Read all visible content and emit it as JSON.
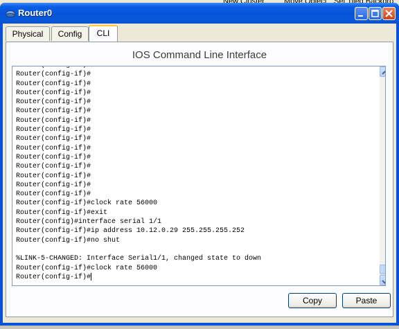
{
  "background": {
    "items": [
      "New Cluster",
      "Move Object",
      "Set Tiled Backgro"
    ]
  },
  "window": {
    "title": "Router0",
    "controls": [
      "minimize-icon",
      "maximize-icon",
      "close-icon"
    ]
  },
  "tabs": [
    {
      "label": "Physical",
      "active": false
    },
    {
      "label": "Config",
      "active": false
    },
    {
      "label": "CLI",
      "active": true
    }
  ],
  "cli": {
    "heading": "IOS Command Line Interface",
    "lines": [
      "Router(config-if)#",
      "Router(config-if)#",
      "Router(config-if)#",
      "Router(config-if)#",
      "Router(config-if)#",
      "Router(config-if)#",
      "Router(config-if)#",
      "Router(config-if)#",
      "Router(config-if)#",
      "Router(config-if)#",
      "Router(config-if)#",
      "Router(config-if)#",
      "Router(config-if)#",
      "Router(config-if)#",
      "Router(config-if)#",
      "Router(config-if)#clock rate 56000",
      "Router(config-if)#exit",
      "Router(config)#interface serial 1/1",
      "Router(config-if)#ip address 10.12.0.29 255.255.255.252",
      "Router(config-if)#no shut",
      "",
      "%LINK-5-CHANGED: Interface Serial1/1, changed state to down",
      "Router(config-if)#clock rate 56000",
      "Router(config-if)#"
    ]
  },
  "buttons": {
    "copy": "Copy",
    "paste": "Paste"
  },
  "colors": {
    "titlebar": "#0553d6",
    "active_tab_accent": "#ffc83c"
  }
}
